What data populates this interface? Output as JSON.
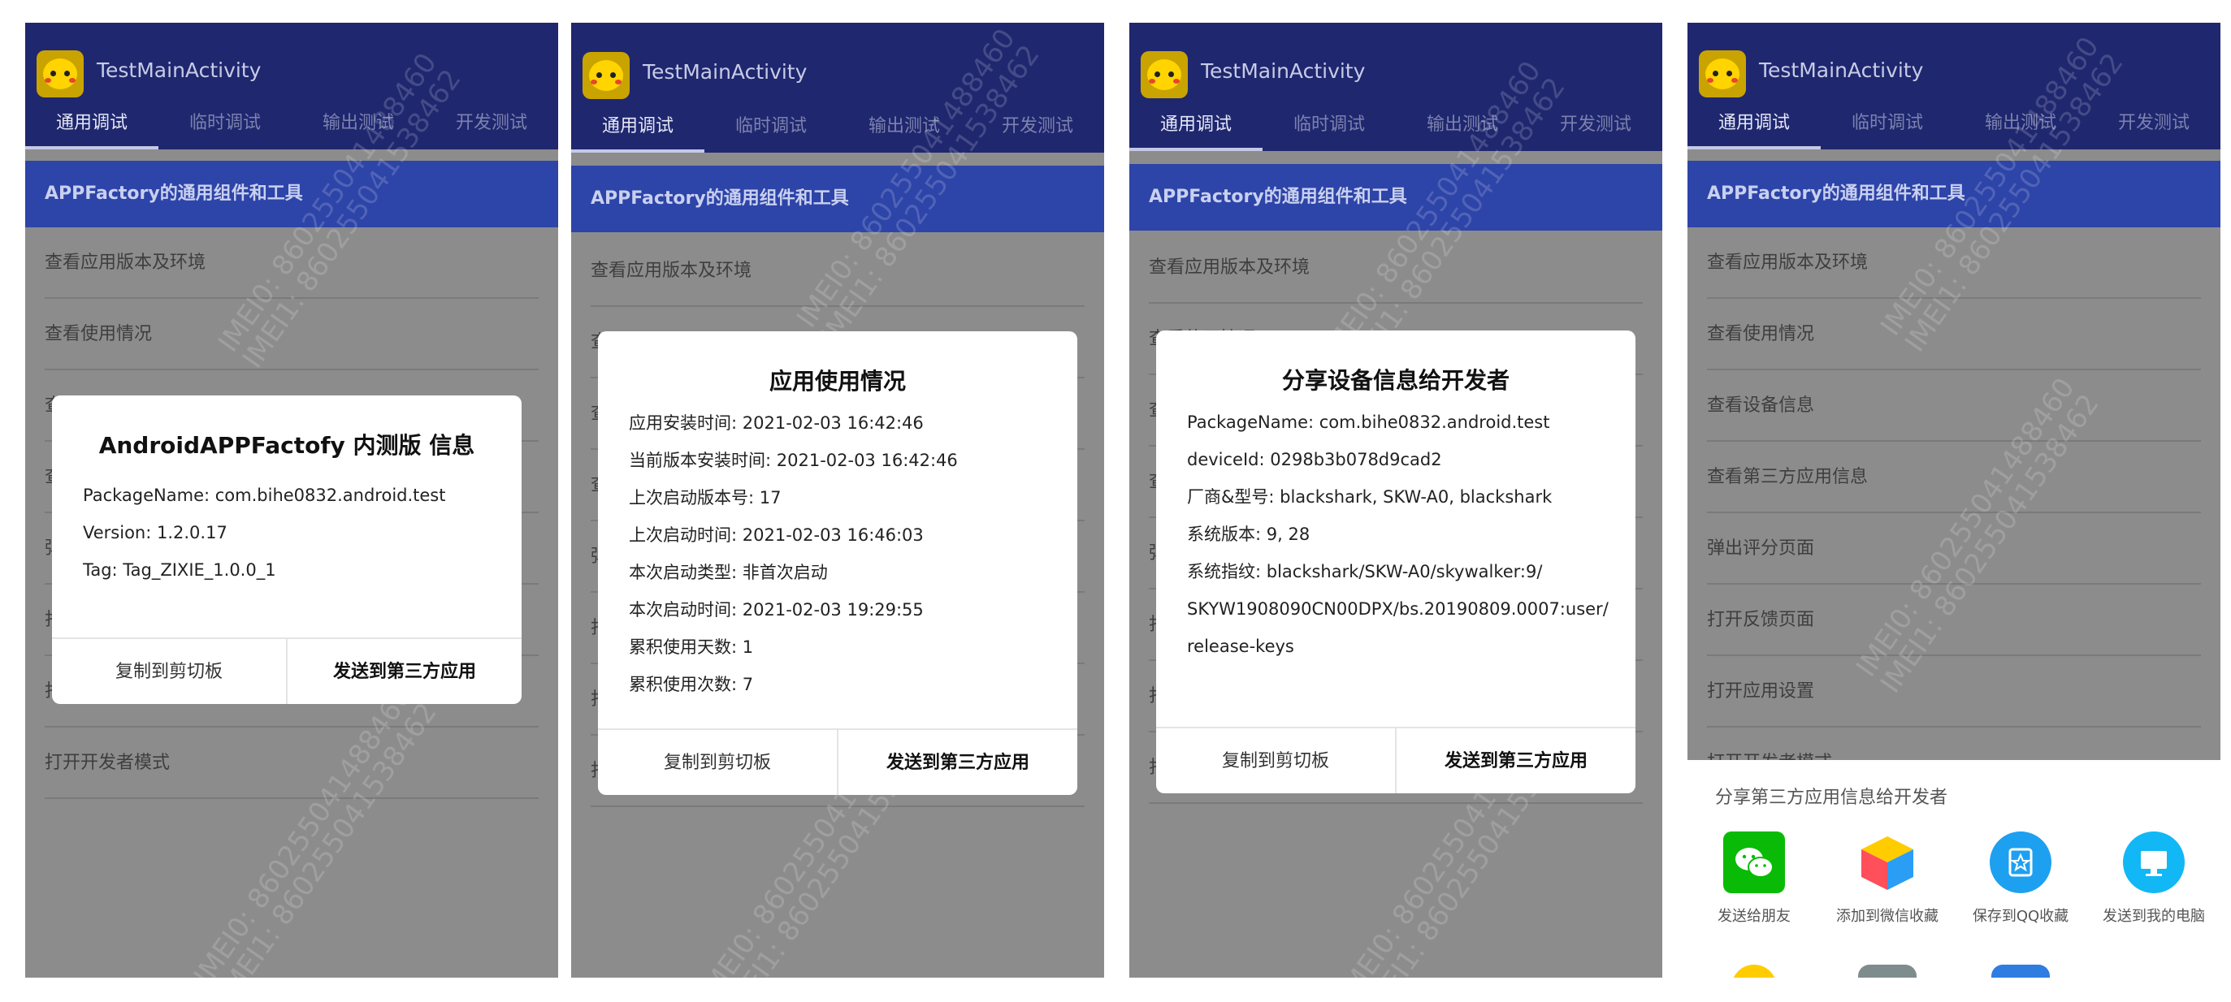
{
  "app": {
    "title": "TestMainActivity",
    "tabs": [
      "通用调试",
      "临时调试",
      "输出测试",
      "开发测试"
    ],
    "section_header": "APPFactory的通用组件和工具"
  },
  "menu": [
    "查看应用版本及环境",
    "查看使用情况",
    "查看设备信息",
    "查看第三方应用信息",
    "弹出评分页面",
    "打开反馈页面",
    "打开应用设置",
    "打开开发者模式"
  ],
  "watermark": {
    "line1": "IMEI0: 860255041488460",
    "line2": "IMEI1: 860255041538462"
  },
  "dialog_version": {
    "title": "AndroidAPPFactofy 内测版 信息",
    "lines": [
      "PackageName: com.bihe0832.android.test",
      "Version: 1.2.0.17",
      "Tag: Tag_ZIXIE_1.0.0_1"
    ],
    "copy_label": "复制到剪切板",
    "send_label": "发送到第三方应用"
  },
  "dialog_usage": {
    "title": "应用使用情况",
    "lines": [
      "应用安装时间: 2021-02-03 16:42:46",
      "当前版本安装时间: 2021-02-03 16:42:46",
      "上次启动版本号: 17",
      "上次启动时间: 2021-02-03 16:46:03",
      "本次启动类型: 非首次启动",
      "本次启动时间: 2021-02-03 19:29:55",
      "累积使用天数: 1",
      "累积使用次数: 7"
    ],
    "copy_label": "复制到剪切板",
    "send_label": "发送到第三方应用"
  },
  "dialog_device": {
    "title": "分享设备信息给开发者",
    "lines": [
      "PackageName: com.bihe0832.android.test",
      "deviceId: 0298b3b078d9cad2",
      "厂商&型号: blackshark, SKW-A0, blackshark",
      "系统版本: 9, 28",
      "系统指纹: blackshark/SKW-A0/skywalker:9/",
      "SKYW1908090CN00DPX/bs.20190809.0007:user/",
      "release-keys"
    ],
    "copy_label": "复制到剪切板",
    "send_label": "发送到第三方应用"
  },
  "share_sheet": {
    "title": "分享第三方应用信息给开发者",
    "items": [
      {
        "label": "发送给朋友",
        "icon": "wechat-icon",
        "color": "#09bb07"
      },
      {
        "label": "添加到微信收藏",
        "icon": "wechat-favorites-icon",
        "color": "#2a9df4"
      },
      {
        "label": "保存到QQ收藏",
        "icon": "qq-favorites-icon",
        "color": "#1ea0f0"
      },
      {
        "label": "发送到我的电脑",
        "icon": "my-computer-icon",
        "color": "#12b7f5"
      }
    ],
    "row2": [
      {
        "icon": "qq-penguin-icon",
        "color": "#ffcc00"
      },
      {
        "icon": "message-icon",
        "color": "#7f8c8d"
      },
      {
        "icon": "bluetooth-icon",
        "color": "#2f7de1"
      }
    ]
  }
}
